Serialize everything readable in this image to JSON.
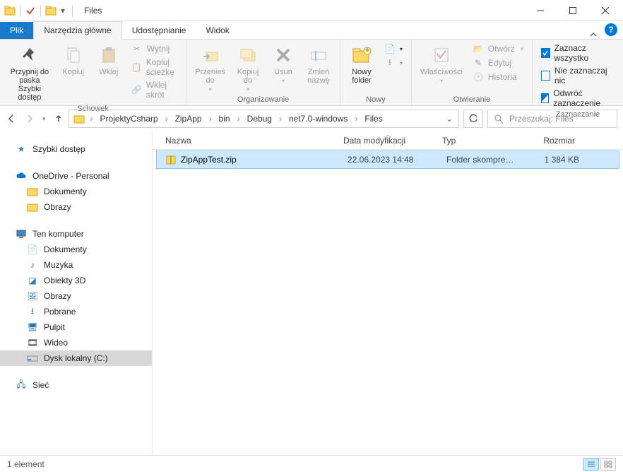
{
  "window": {
    "title": "Files"
  },
  "tabs": {
    "file": "Plik",
    "main": "Narzędzia główne",
    "share": "Udostępnianie",
    "view": "Widok"
  },
  "ribbon": {
    "pin": "Przypnij do paska\nSzybki dostęp",
    "copy": "Kopiuj",
    "paste": "Wklej",
    "cut": "Wytnij",
    "copypath": "Kopiuj ścieżkę",
    "pasteshortcut": "Wklej skrót",
    "clipboard_label": "Schowek",
    "moveto": "Przenieś\ndo",
    "copyto": "Kopiuj\ndo",
    "delete": "Usuń",
    "rename": "Zmień\nnazwę",
    "organize_label": "Organizowanie",
    "newfolder": "Nowy\nfolder",
    "new_label": "Nowy",
    "properties": "Właściwości",
    "open": "Otwórz",
    "edit": "Edytuj",
    "history": "Historia",
    "opening_label": "Otwieranie",
    "selectall": "Zaznacz wszystko",
    "selectnone": "Nie zaznaczaj nic",
    "invert": "Odwróć zaznaczenie",
    "select_label": "Zaznaczanie"
  },
  "breadcrumb": [
    "ProjektyCsharp",
    "ZipApp",
    "bin",
    "Debug",
    "net7.0-windows",
    "Files"
  ],
  "search_placeholder": "Przeszukaj: Files",
  "columns": {
    "name": "Nazwa",
    "date": "Data modyfikacji",
    "type": "Typ",
    "size": "Rozmiar"
  },
  "rows": [
    {
      "name": "ZipAppTest.zip",
      "date": "22.06.2023 14:48",
      "type": "Folder skompreso...",
      "size": "1 384 KB"
    }
  ],
  "tree": {
    "quick": "Szybki dostęp",
    "onedrive": "OneDrive - Personal",
    "od_docs": "Dokumenty",
    "od_pics": "Obrazy",
    "pc": "Ten komputer",
    "pc_docs": "Dokumenty",
    "pc_music": "Muzyka",
    "pc_3d": "Obiekty 3D",
    "pc_pics": "Obrazy",
    "pc_dl": "Pobrane",
    "pc_desk": "Pulpit",
    "pc_video": "Wideo",
    "pc_c": "Dysk lokalny (C:)",
    "network": "Sieć"
  },
  "status": {
    "count": "1 element"
  }
}
